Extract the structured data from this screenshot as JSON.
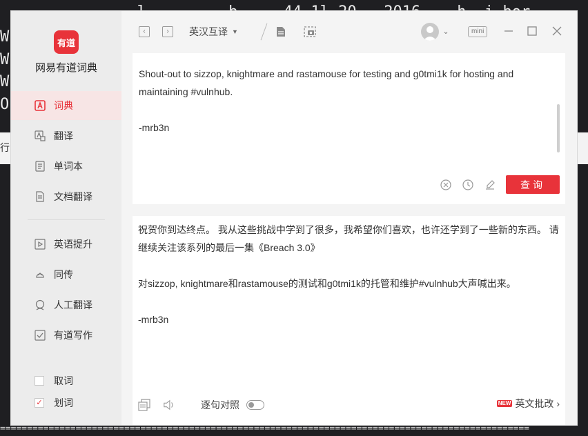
{
  "background": {
    "terminal_lines": [
      "               l         b     44 1l 20   2016    h  i bor",
      "W",
      "W",
      "W",
      "O"
    ],
    "band_text": "行",
    "dashes": "=================================================================================================="
  },
  "app": {
    "logo_text": "有道",
    "name": "网易有道词典"
  },
  "sidebar": {
    "items": [
      {
        "label": "词典",
        "icon": "dictionary-icon",
        "active": true
      },
      {
        "label": "翻译",
        "icon": "translate-icon"
      },
      {
        "label": "单词本",
        "icon": "wordbook-icon"
      },
      {
        "label": "文档翻译",
        "icon": "document-translate-icon"
      },
      {
        "label": "英语提升",
        "icon": "english-improve-icon"
      },
      {
        "label": "同传",
        "icon": "simultaneous-interpretation-icon"
      },
      {
        "label": "人工翻译",
        "icon": "human-translation-icon"
      },
      {
        "label": "有道写作",
        "icon": "writing-icon"
      }
    ],
    "checks": [
      {
        "label": "取词",
        "checked": false
      },
      {
        "label": "划词",
        "checked": true
      }
    ]
  },
  "topbar": {
    "back": "‹",
    "forward": "›",
    "mode": "英汉互译",
    "mini": "mini"
  },
  "input": {
    "text": "Shout-out to sizzop, knightmare and rastamouse for testing and g0tmi1k for hosting and\nmaintaining #vulnhub. \n\n-mrb3n",
    "query_label": "查询"
  },
  "output": {
    "text": "祝贺你到达终点。 我从这些挑战中学到了很多，我希望你们喜欢，也许还学到了一些新的东西。 请\n继续关注该系列的最后一集《Breach 3.0》\n\n对sizzop, knightmare和rastamouse的测试和g0tmi1k的托管和维护#vulnhub大声喊出来。\n\n-mrb3n",
    "compare_label": "逐句对照",
    "new_badge": "NEW",
    "correction_label": "英文批改 ›"
  },
  "colors": {
    "accent": "#e8333a",
    "sidebar_bg": "#ececec",
    "active_bg": "#f7e5e5"
  }
}
